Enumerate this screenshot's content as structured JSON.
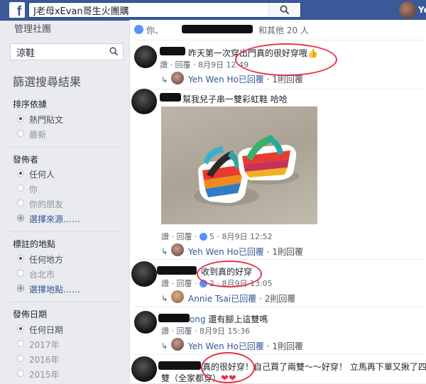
{
  "topbar": {
    "logo": "f",
    "search_value": "J老母xEvan哥生火團購",
    "user_name": "Ye"
  },
  "sidebar": {
    "manage": "管理社團",
    "search_value": "涼鞋",
    "filter_title": "篩選搜尋結果",
    "sort": {
      "heading": "排序依據",
      "options": [
        "熱門貼文",
        "最新"
      ],
      "selected": 0
    },
    "poster": {
      "heading": "發佈者",
      "options": [
        "任何人",
        "你",
        "你的朋友"
      ],
      "selected": 0,
      "choose": "選擇來源……"
    },
    "location": {
      "heading": "標註的地點",
      "options": [
        "任何地方",
        "台北市"
      ],
      "selected": 0,
      "choose": "選擇地點……"
    },
    "date": {
      "heading": "發佈日期",
      "options": [
        "任何日期",
        "2017年",
        "2016年",
        "2015年"
      ],
      "selected": 0
    }
  },
  "post": {
    "likes_prefix": "你、",
    "likes_suffix": "和其他 20 人"
  },
  "comments": [
    {
      "text": "昨天第一次穿出門真的很好穿哦👍",
      "actions": "讚 · 回覆 · 8月9日 12:49",
      "reply": {
        "name": "Yeh Wen Ho",
        "text": "已回覆",
        "count": " · 1則回覆"
      }
    },
    {
      "text": "幫我兒子串一雙彩虹鞋 哈哈",
      "actions_pre": "讚 · 回覆 · ",
      "likes": "5",
      "actions_post": " · 8月9日 12:52",
      "reply": {
        "name": "Yeh Wen Ho",
        "text": "已回覆",
        "count": " · 1則回覆"
      }
    },
    {
      "text": "收到真的好穿",
      "actions_pre": "讚 · 回覆 · ",
      "likes": "2",
      "actions_post": " · 8月9日 13:05",
      "reply": {
        "name": "Annie Tsai",
        "text": "已回覆",
        "count": " · 2則回覆"
      }
    },
    {
      "name_partial": "ong",
      "text": "還有腳上這雙嗎",
      "actions": "讚 · 回覆 · 8月9日 15:36",
      "reply": {
        "name": "Yeh Wen Ho",
        "text": "已回覆",
        "count": " · 1則回覆"
      }
    },
    {
      "text_line1": "真的很好穿！自己買了兩雙～～好穿！ 立馬再下單又揪了四",
      "text_line2": "雙（全家都穿）",
      "hearts": "❤❤"
    }
  ],
  "colors": {
    "topbar": "#3b5998",
    "link": "#365899",
    "annotation": "#e8334a",
    "like_blue": "#5890ff"
  }
}
